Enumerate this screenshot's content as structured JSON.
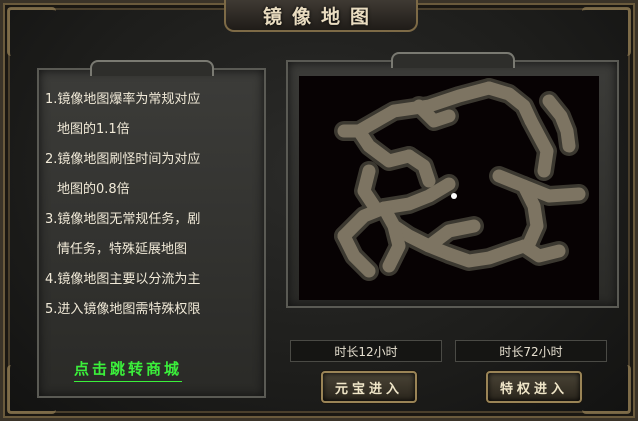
{
  "title": "镜像地图",
  "rules": [
    {
      "text": "1.镜像地图爆率为常规对应",
      "indent": false
    },
    {
      "text": "地图的1.1倍",
      "indent": true
    },
    {
      "text": "2.镜像地图刷怪时间为对应",
      "indent": false
    },
    {
      "text": "地图的0.8倍",
      "indent": true
    },
    {
      "text": "3.镜像地图无常规任务，剧",
      "indent": false
    },
    {
      "text": "情任务，特殊延展地图",
      "indent": true
    },
    {
      "text": "4.镜像地图主要以分流为主",
      "indent": false
    },
    {
      "text": "5.进入镜像地图需特殊权限",
      "indent": false
    }
  ],
  "shop_link": "点击跳转商城",
  "durations": {
    "a": "时长12小时",
    "b": "时长72小时"
  },
  "buttons": {
    "yuanbao": "元宝进入",
    "privilege": "特权进入"
  },
  "map": {
    "background": "#070203",
    "floor": "#7d7462",
    "wall": "#3b3830",
    "player_marker": "#ffffff"
  }
}
